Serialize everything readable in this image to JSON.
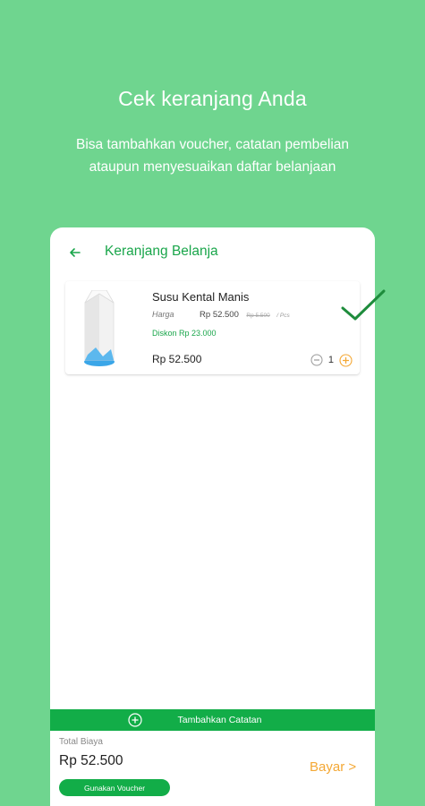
{
  "hero": {
    "title": "Cek keranjang Anda",
    "subtitle_line1": "Bisa tambahkan voucher, catatan pembelian",
    "subtitle_line2": "ataupun menyesuaikan daftar belanjaan"
  },
  "appbar": {
    "back_icon": "arrow-left-icon",
    "title": "Keranjang Belanja"
  },
  "cart_item": {
    "name": "Susu Kental Manis",
    "price_label": "Harga",
    "price": "Rp 52.500",
    "original_price": "Rp 5.500",
    "unit": "/ Pcs",
    "discount": "Diskon Rp 23.000",
    "subtotal": "Rp 52.500",
    "quantity": "1",
    "minus_icon": "minus-circle-icon",
    "plus_icon": "plus-circle-icon",
    "selected_icon": "checkmark-icon"
  },
  "note_bar": {
    "icon": "plus-circle-icon",
    "label": "Tambahkan Catatan"
  },
  "footer": {
    "total_label": "Total Biaya",
    "total_value": "Rp 52.500",
    "voucher_button": "Gunakan Voucher",
    "pay_button": "Bayar >"
  },
  "colors": {
    "background": "#6fd58f",
    "primary_green": "#12ad48",
    "pay_orange": "#f4a835"
  }
}
